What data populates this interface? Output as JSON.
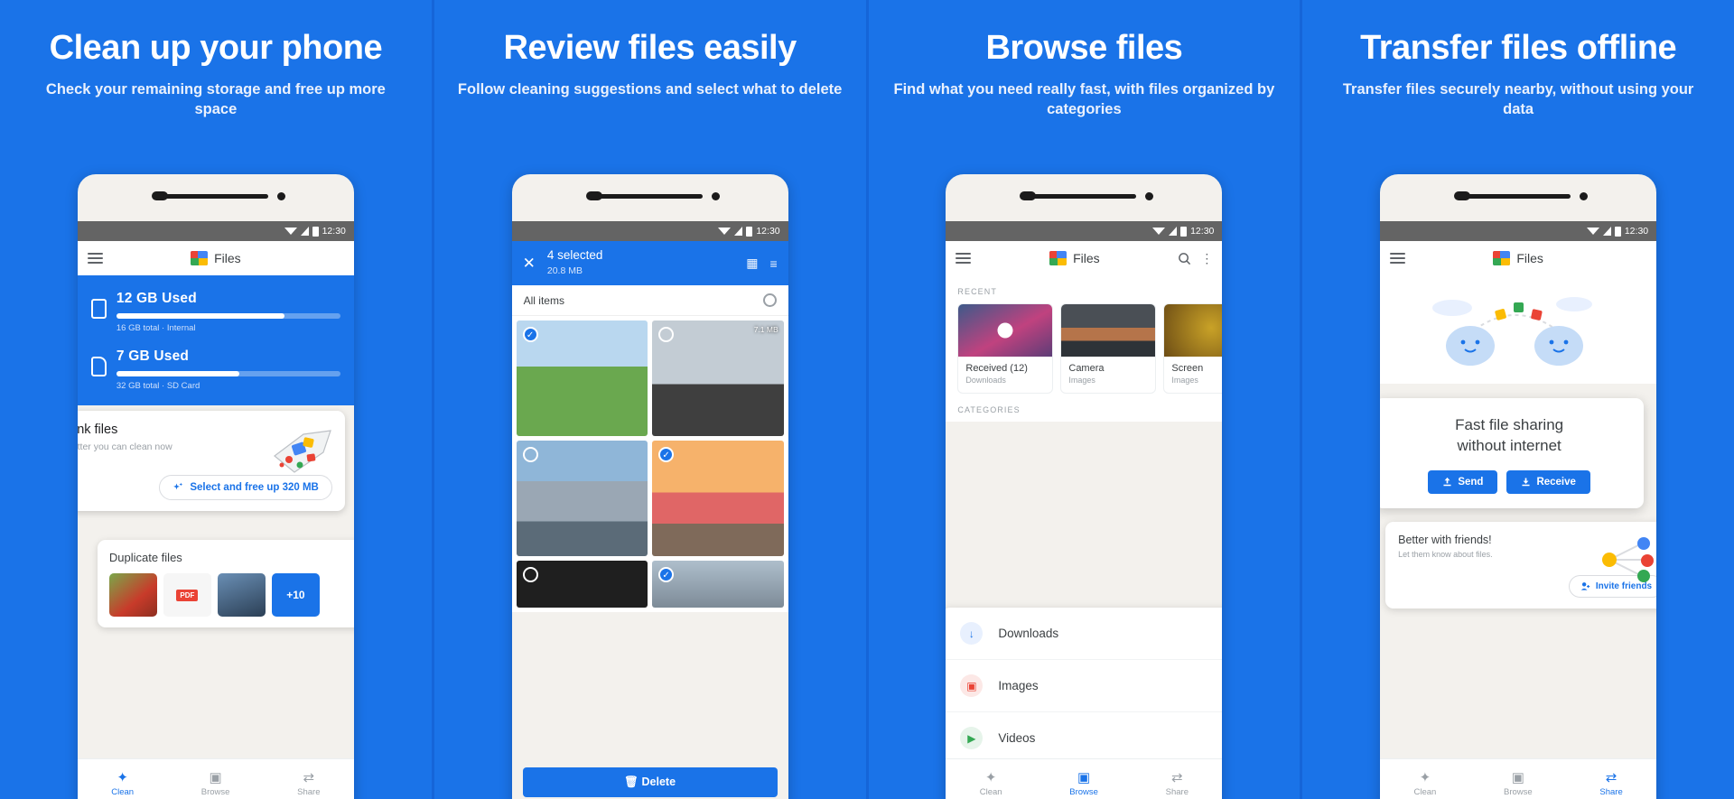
{
  "theme": {
    "brand_blue": "#1a73e8",
    "panel_bg": "#1a73e8",
    "white": "#ffffff",
    "grey_text": "#9aa0a6"
  },
  "panels": [
    {
      "headline": "Clean up your phone",
      "subline": "Check your remaining storage and free up more space",
      "status_time": "12:30",
      "app_title": "Files",
      "storage": [
        {
          "title": "12 GB Used",
          "subtitle": "16 GB total · Internal",
          "percent": 75
        },
        {
          "title": "7 GB Used",
          "subtitle": "32 GB total · SD Card",
          "percent": 55
        }
      ],
      "junk_card": {
        "title": "Junk files",
        "subtitle": "Clutter you can clean now",
        "button": "Select and free up 320 MB"
      },
      "dup_card": {
        "title": "Duplicate files",
        "more_badge": "+10"
      },
      "bottom_nav": [
        {
          "label": "Clean",
          "icon": "broom-icon",
          "active": true
        },
        {
          "label": "Browse",
          "icon": "browse-icon",
          "active": false
        },
        {
          "label": "Share",
          "icon": "share-icon",
          "active": false
        }
      ]
    },
    {
      "headline": "Review files easily",
      "subline": "Follow cleaning suggestions and select what to delete",
      "status_time": "12:30",
      "selection": {
        "count_label": "4 selected",
        "size_label": "20.8 MB",
        "close_icon": "close-icon",
        "grid_icon": "grid-view-icon",
        "sort_icon": "sort-icon"
      },
      "all_items_label": "All items",
      "tiles": [
        {
          "name": "field-photo",
          "selected": true,
          "size": ""
        },
        {
          "name": "cliff-photo",
          "selected": false,
          "size": "7.1 MB"
        },
        {
          "name": "mountain-photo",
          "selected": false,
          "size": ""
        },
        {
          "name": "sunset-surfer-photo",
          "selected": true,
          "size": ""
        },
        {
          "name": "tire-photo",
          "selected": false,
          "size": ""
        },
        {
          "name": "building-photo",
          "selected": true,
          "size": ""
        }
      ],
      "delete_button": "Delete"
    },
    {
      "headline": "Browse files",
      "subline": "Find what you need really fast, with files organized by categories",
      "status_time": "12:30",
      "app_title": "Files",
      "search_icon": "search-icon",
      "overflow_icon": "more-vert-icon",
      "recent_header": "RECENT",
      "recent": [
        {
          "title": "Received (12)",
          "subtitle": "Downloads",
          "thumb": "blossom-video"
        },
        {
          "title": "Camera",
          "subtitle": "Images",
          "thumb": "storm-photo"
        },
        {
          "title": "Screen",
          "subtitle": "Images",
          "thumb": "leopard-photo"
        }
      ],
      "categories_header": "CATEGORIES",
      "categories": [
        {
          "label": "Downloads",
          "icon": "download-icon",
          "color": "#1a73e8"
        },
        {
          "label": "Images",
          "icon": "image-icon",
          "color": "#ea4335"
        },
        {
          "label": "Videos",
          "icon": "video-icon",
          "color": "#34a853"
        }
      ],
      "bottom_nav": [
        {
          "label": "Clean",
          "icon": "broom-icon",
          "active": false
        },
        {
          "label": "Browse",
          "icon": "browse-icon",
          "active": true
        },
        {
          "label": "Share",
          "icon": "share-icon",
          "active": false
        }
      ]
    },
    {
      "headline": "Transfer files offline",
      "subline": "Transfer files securely nearby, without using your data",
      "status_time": "12:30",
      "app_title": "Files",
      "share_card": {
        "title_line1": "Fast file sharing",
        "title_line2": "without internet",
        "send_button": "Send",
        "receive_button": "Receive"
      },
      "friends_card": {
        "title": "Better with friends!",
        "subtitle": "Let them know about files.",
        "button": "Invite friends"
      },
      "bottom_nav": [
        {
          "label": "Clean",
          "icon": "broom-icon",
          "active": false
        },
        {
          "label": "Browse",
          "icon": "browse-icon",
          "active": false
        },
        {
          "label": "Share",
          "icon": "share-icon",
          "active": true
        }
      ]
    }
  ]
}
